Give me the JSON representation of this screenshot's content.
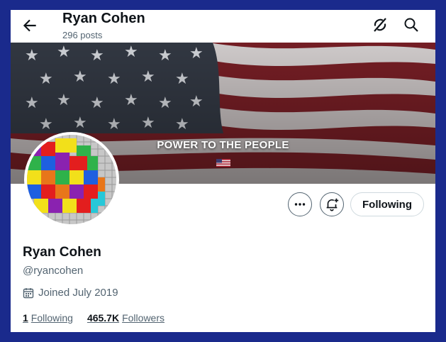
{
  "header": {
    "title": "Ryan Cohen",
    "post_count": "296 posts"
  },
  "banner": {
    "text": "POWER TO THE PEOPLE"
  },
  "actions": {
    "following_label": "Following"
  },
  "profile": {
    "name": "Ryan Cohen",
    "handle": "@ryancohen",
    "joined": "Joined July 2019",
    "following_count": "1",
    "following_label": "Following",
    "followers_count": "465.7K",
    "followers_label": "Followers"
  },
  "icons": [
    "back-arrow-icon",
    "grok-icon",
    "search-icon",
    "more-icon",
    "notification-bell-icon",
    "calendar-icon"
  ],
  "colors": {
    "page_border": "#1a2a8c",
    "text_primary": "#0f1419",
    "text_secondary": "#536471"
  }
}
